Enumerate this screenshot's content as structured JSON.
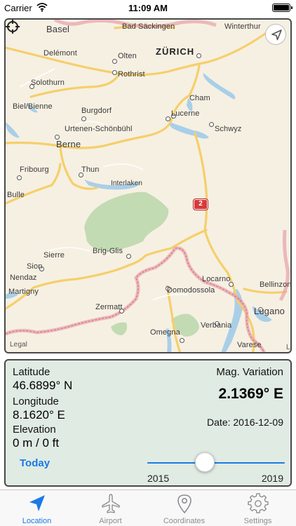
{
  "status_bar": {
    "carrier": "Carrier",
    "time": "11:09 AM"
  },
  "map": {
    "labels": {
      "basel": "Basel",
      "bad_sackingen": "Bad Säckingen",
      "winterthur": "Winterthur",
      "delemont": "Delémont",
      "olten": "Olten",
      "zurich": "ZÜRICH",
      "rothrist": "Rothrist",
      "solothurn": "Solothurn",
      "biel": "Biel/Bienne",
      "cham": "Cham",
      "burgdorf": "Burgdorf",
      "lucerne": "Lucerne",
      "urtenen": "Urtenen-Schönbühl",
      "schwyz": "Schwyz",
      "berne": "Berne",
      "fribourg": "Fribourg",
      "thun": "Thun",
      "interlaken": "Interlaken",
      "bulle": "Bulle",
      "sierre": "Sierre",
      "brig": "Brig-Glis",
      "sion": "Sion",
      "nendaz": "Nendaz",
      "martigny": "Martigny",
      "locarno": "Locarno",
      "bellinzona": "Bellinzona",
      "domodossola": "Domodossola",
      "zermatt": "Zermatt",
      "lugano": "Lugano",
      "verbania": "Verbania",
      "omegna": "Omegna",
      "varese": "Varese",
      "legal": "Legal",
      "edge_l": "L"
    },
    "road_shield": "2",
    "colors": {
      "land": "#f6f0e3",
      "water": "#a9cfe8",
      "park": "#c3dbb3",
      "highway": "#f5cf6a",
      "border": "#e8a6ad"
    }
  },
  "info": {
    "latitude_label": "Latitude",
    "latitude_value": "46.6899° N",
    "longitude_label": "Longitude",
    "longitude_value": "8.1620° E",
    "elevation_label": "Elevation",
    "elevation_value": "0 m /  0 ft",
    "mag_variation_label": "Mag. Variation",
    "mag_variation_value": "2.1369° E",
    "date_text": "Date: 2016-12-09",
    "today_button": "Today",
    "slider": {
      "min_label": "2015",
      "max_label": "2019",
      "value_fraction": 0.42
    }
  },
  "tabs": [
    {
      "label": "Location",
      "icon": "location-arrow-icon",
      "active": true
    },
    {
      "label": "Airport",
      "icon": "airplane-icon",
      "active": false
    },
    {
      "label": "Coordinates",
      "icon": "map-pin-icon",
      "active": false
    },
    {
      "label": "Settings",
      "icon": "gear-icon",
      "active": false
    }
  ],
  "accent_color": "#1a7ae6"
}
